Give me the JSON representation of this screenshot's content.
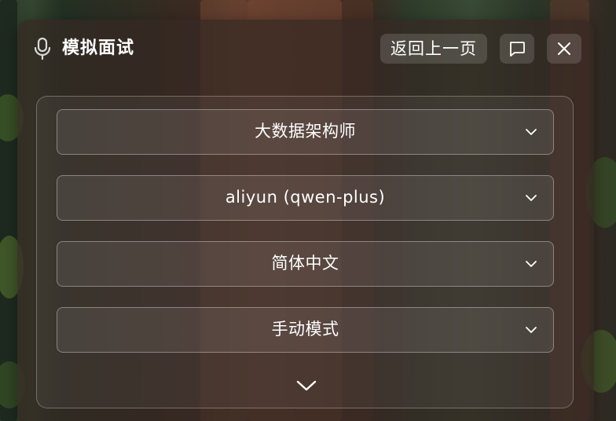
{
  "panel": {
    "title": "模拟面试",
    "back_label": "返回上一页"
  },
  "icons": {
    "mic": "microphone-icon",
    "chat": "chat-bubble-icon",
    "close": "close-icon",
    "chevron": "chevron-down-icon",
    "expand": "expand-more-icon"
  },
  "settings": {
    "role": "大数据架构师",
    "model": "aliyun (qwen-plus)",
    "language": "简体中文",
    "mode": "手动模式"
  }
}
